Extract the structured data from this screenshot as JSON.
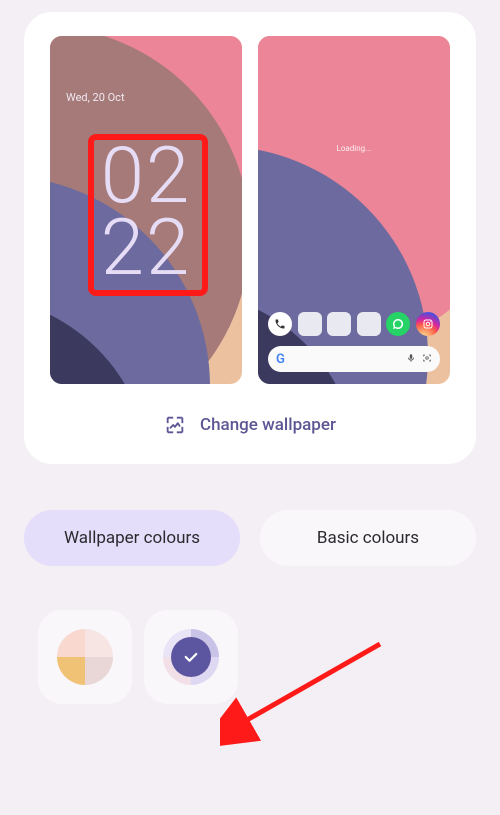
{
  "lockscreen": {
    "date": "Wed, 20 Oct",
    "time_top": "02",
    "time_bottom": "22"
  },
  "homescreen": {
    "loading_text": "Loading...",
    "search_letter": "G"
  },
  "change_wallpaper_label": "Change wallpaper",
  "tabs": {
    "wallpaper_colours": "Wallpaper colours",
    "basic_colours": "Basic colours"
  },
  "icons": {
    "change": "change-wallpaper-icon",
    "check": "check-icon",
    "phone": "phone-icon",
    "mic": "mic-icon",
    "lens": "lens-icon"
  }
}
